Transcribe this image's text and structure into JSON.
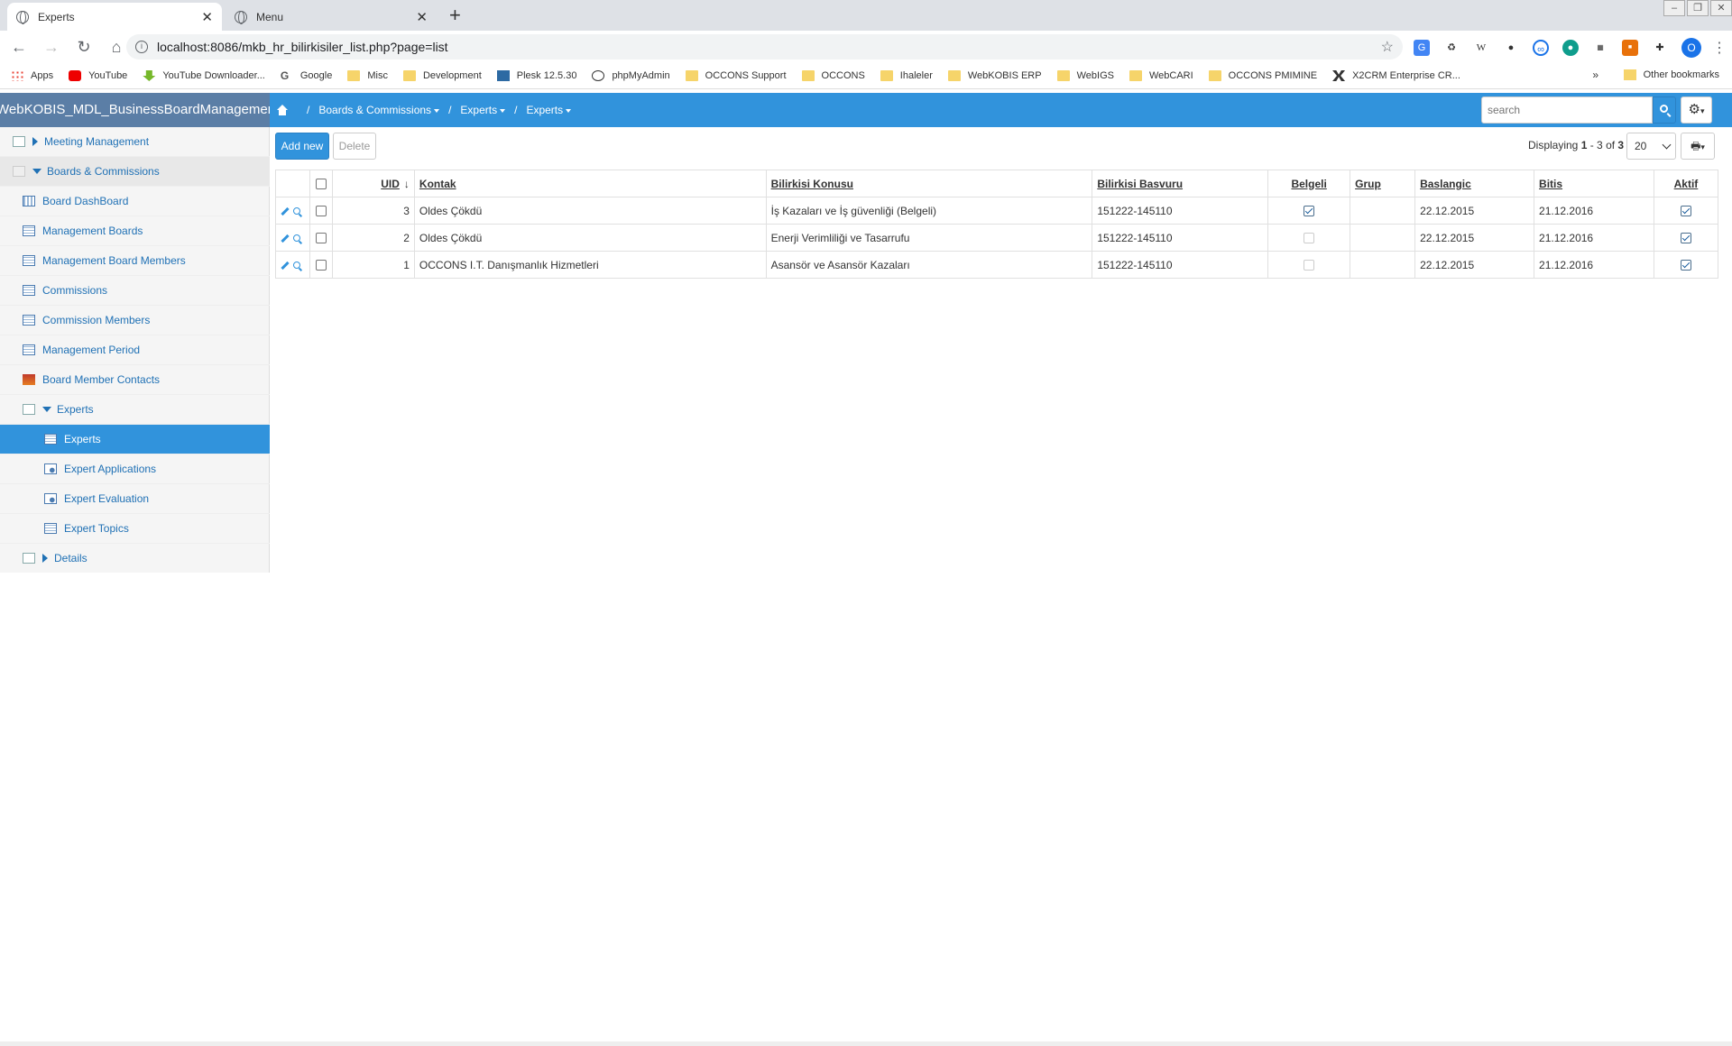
{
  "browser": {
    "tabs": [
      {
        "title": "Experts",
        "close": "✕"
      },
      {
        "title": "Menu",
        "close": "✕"
      }
    ],
    "new_tab": "+",
    "url": "localhost:8086/mkb_hr_bilirkisiler_list.php?page=list",
    "profile_initial": "O",
    "bookmarks": [
      "Apps",
      "YouTube",
      "YouTube Downloader...",
      "Google",
      "Misc",
      "Development",
      "Plesk 12.5.30",
      "phpMyAdmin",
      "OCCONS Support",
      "OCCONS",
      "Ihaleler",
      "WebKOBIS ERP",
      "WebIGS",
      "WebCARI",
      "OCCONS PMIMINE",
      "X2CRM Enterprise CR..."
    ],
    "more_bookmarks": "»",
    "other_bookmarks": "Other bookmarks"
  },
  "header": {
    "brand": "WebKOBIS_MDL_BusinessBoardManagement",
    "breadcrumb": [
      "Boards & Commissions",
      "Experts",
      "Experts"
    ],
    "search_placeholder": "search"
  },
  "sidebar": {
    "items": [
      {
        "label": "Meeting Management"
      },
      {
        "label": "Boards & Commissions"
      },
      {
        "label": "Board DashBoard"
      },
      {
        "label": "Management Boards"
      },
      {
        "label": "Management Board Members"
      },
      {
        "label": "Commissions"
      },
      {
        "label": "Commission Members"
      },
      {
        "label": "Management Period"
      },
      {
        "label": "Board Member Contacts"
      },
      {
        "label": "Experts"
      },
      {
        "label": "Experts"
      },
      {
        "label": "Expert Applications"
      },
      {
        "label": "Expert Evaluation"
      },
      {
        "label": "Expert Topics"
      },
      {
        "label": "Details"
      }
    ]
  },
  "toolbar": {
    "add_label": "Add new",
    "delete_label": "Delete",
    "display_prefix": "Displaying ",
    "display_from": "1",
    "display_mid": " - 3 of ",
    "display_total": "3",
    "page_size": "20"
  },
  "table": {
    "columns": [
      "UID",
      "Kontak",
      "Bilirkisi Konusu",
      "Bilirkisi Basvuru",
      "Belgeli",
      "Grup",
      "Baslangic",
      "Bitis",
      "Aktif"
    ],
    "sort_indicator": "↓",
    "rows": [
      {
        "uid": "3",
        "kontak": "Oldes Çökdü",
        "konu": "İş Kazaları ve İş güvenliği (Belgeli)",
        "basvuru": "151222-145110",
        "belgeli": true,
        "grup": "",
        "baslangic": "22.12.2015",
        "bitis": "21.12.2016",
        "aktif": true
      },
      {
        "uid": "2",
        "kontak": "Oldes Çökdü",
        "konu": "Enerji Verimliliği ve Tasarrufu",
        "basvuru": "151222-145110",
        "belgeli": false,
        "grup": "",
        "baslangic": "22.12.2015",
        "bitis": "21.12.2016",
        "aktif": true
      },
      {
        "uid": "1",
        "kontak": "OCCONS I.T. Danışmanlık Hizmetleri",
        "konu": "Asansör ve Asansör Kazaları",
        "basvuru": "151222-145110",
        "belgeli": false,
        "grup": "",
        "baslangic": "22.12.2015",
        "bitis": "21.12.2016",
        "aktif": true
      }
    ]
  }
}
